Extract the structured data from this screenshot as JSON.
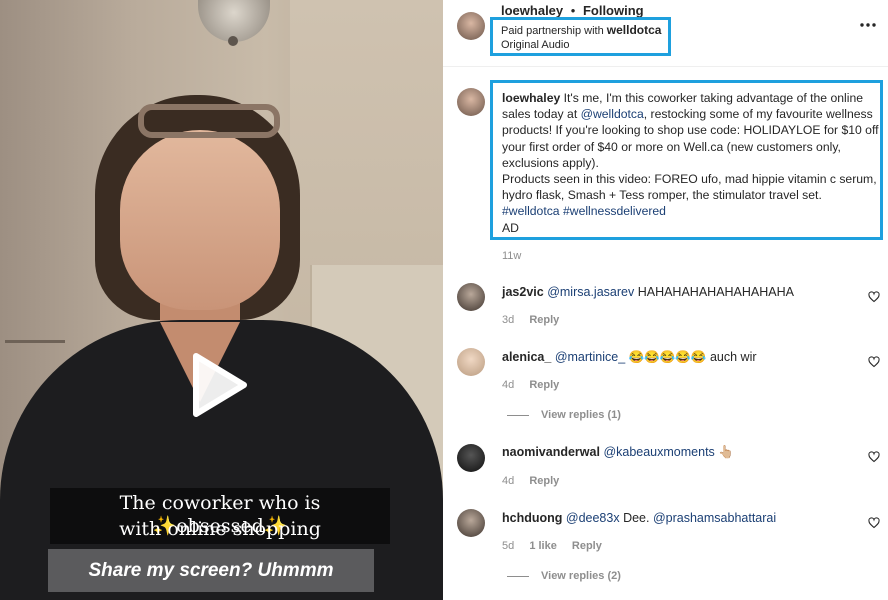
{
  "video": {
    "caption_line1": "The coworker who is ✨obsessed✨",
    "caption_line2": "with online shopping",
    "banner_text": "Share my screen? Uhmmm"
  },
  "header": {
    "username": "loewhaley",
    "separator": "•",
    "follow_state": "Following",
    "partnership_prefix": "Paid partnership with",
    "partner": "welldotca",
    "audio": "Original Audio",
    "more_icon": "more-horizontal-icon"
  },
  "post": {
    "username": "loewhaley",
    "text_1": "It's me, I'm this coworker taking advantage of the online sales today at",
    "mention": "@welldotca",
    "text_2": ", restocking some of my favourite wellness products! If you're looking to shop use code: HOLIDAYLOE for $10 off your first order of $40 or more on Well.ca (new customers only, exclusions apply).",
    "products_line": "Products seen in this video: FOREO ufo, mad hippie vitamin c serum, hydro flask, Smash + Tess romper, the stimulator travel set.",
    "hashtag_1": "#welldotca",
    "hashtag_2": "#wellnessdelivered",
    "ad_label": "AD",
    "age": "11w"
  },
  "comments": [
    {
      "username": "jas2vic",
      "mention": "@mirsa.jasarev",
      "text": "HAHAHAHAHAHAHAHAHA",
      "age": "3d",
      "reply": "Reply"
    },
    {
      "username": "alenica_",
      "mention": "@martinice_",
      "text": "😂😂😂😂😂 auch wir",
      "age": "4d",
      "reply": "Reply",
      "view_replies": "View replies (1)"
    },
    {
      "username": "naomivanderwal",
      "mention": "@kabeauxmoments",
      "text": "👆🏼",
      "age": "4d",
      "reply": "Reply"
    },
    {
      "username": "hchduong",
      "mention": "@dee83x",
      "text": "Dee.",
      "mention_2": "@prashamsabhattarai",
      "age": "5d",
      "likes": "1 like",
      "reply": "Reply",
      "view_replies": "View replies (2)"
    }
  ],
  "colors": {
    "highlight": "#1ea0de",
    "link": "#1b3f74",
    "muted": "#8e8e8e"
  }
}
